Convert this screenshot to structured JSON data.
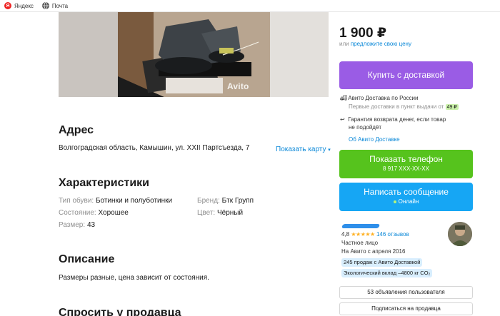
{
  "bookmarks": [
    {
      "label": "Яндекс",
      "icon": "yandex-icon"
    },
    {
      "label": "Почта",
      "icon": "globe-icon"
    }
  ],
  "photo": {
    "watermark": "Avito"
  },
  "address": {
    "heading": "Адрес",
    "text": "Волгоградская область, Камышин, ул. XXII Партсъезда, 7",
    "show_map": "Показать карту"
  },
  "characteristics": {
    "heading": "Характеристики",
    "items": [
      {
        "key": "Тип обуви:",
        "value": "Ботинки и полуботинки"
      },
      {
        "key": "Состояние:",
        "value": "Хорошее"
      },
      {
        "key": "Размер:",
        "value": "43"
      },
      {
        "key": "Бренд:",
        "value": "Бтк Групп"
      },
      {
        "key": "Цвет:",
        "value": "Чёрный"
      }
    ]
  },
  "description": {
    "heading": "Описание",
    "text": "Размеры разные, цена зависит от состояния."
  },
  "next_section": {
    "heading": "Спросить у продавца"
  },
  "price": {
    "value": "1 900 ₽",
    "or": "или",
    "offer_link": "предложите свою цену"
  },
  "buy_button": "Купить с доставкой",
  "delivery": {
    "title": "Авито Доставка по России",
    "first_deliveries": "Первые доставки в пункт выдачи от",
    "price_badge": "49 ₽",
    "guarantee_line1": "Гарантия возврата денег, если товар",
    "guarantee_line2": "не подойдёт",
    "about_link": "Об Авито Доставке"
  },
  "phone_button": {
    "title": "Показать телефон",
    "number": "8 917 XXX-XX-XX"
  },
  "message_button": {
    "title": "Написать сообщение",
    "status": "Онлайн"
  },
  "seller": {
    "rating": "4,8",
    "stars": "★★★★★",
    "reviews": "146 отзывов",
    "type": "Частное лицо",
    "since": "На Авито с апреля 2016",
    "chips": [
      "245 продаж с Авито Доставкой",
      "Экологический вклад –4800 кг CO₂"
    ]
  },
  "user_ads_button": "53 объявления пользователя",
  "subscribe_button": "Подписаться на продавца",
  "colors": {
    "buy": "#9a5ce5",
    "phone": "#56c31d",
    "message": "#16a6f4",
    "link": "#0a88d8"
  }
}
